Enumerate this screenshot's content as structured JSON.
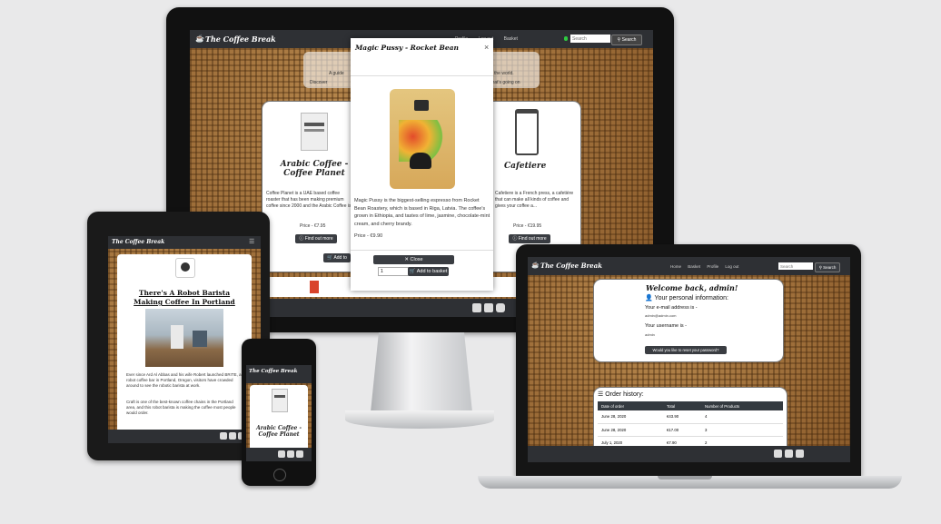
{
  "brand": "The Coffee Break",
  "navbar": {
    "links": [
      "Home",
      "Basket",
      "Profile",
      "Log out"
    ],
    "search_placeholder": "Search",
    "search_button": "Search"
  },
  "modal": {
    "title": "Magic Pussy - Rocket Bean",
    "close_x": "×",
    "description": "Magic Pussy is the biggest-selling espresso from Rocket Bean Roastery, which is based in Riga, Latvia. The coffee's grown in Ethiopia, and tastes of lime, jasmine, chocolate-mint cream, and cherry brandy.",
    "price": "Price - €9.90",
    "close_button": "Close",
    "quantity": "1",
    "add_button": "Add to basket"
  },
  "desktop": {
    "banner_line1": "A guide",
    "banner_line1b": "the world.",
    "banner_line2": "Discover",
    "banner_line2b": "what's going on",
    "products": [
      {
        "name": "Arabic Coffee - Coffee Planet",
        "desc": "Coffee Planet is a UAE based coffee roaster that has been making premium coffee since 2000 and the Arabic Coffee is one of...",
        "price": "Price - €7.95",
        "button": "Find out more"
      },
      {
        "name": "Cafetiere",
        "desc": "Cafetiere is a French press, a cafetière that can make all kinds of coffee and gives your coffee a...",
        "price": "Price - €19.95",
        "button": "Find out more"
      }
    ],
    "add_label": "Add to"
  },
  "tablet": {
    "article_title": "There's A Robot Barista Making Coffee In Portland",
    "para1": "Ever since Ard Al Abbas and his wife Robert launched BRITE, a robot coffee bar in Portland, Oregon, visitors have crowded around to see the robotic barista at work.",
    "para2": "Craft is one of the best-known coffee chains in the Portland area, and this robot barista is making the coffee most people would order."
  },
  "phone": {
    "product_name": "Arabic Coffee - Coffee Planet"
  },
  "laptop": {
    "welcome": "Welcome back, admin!",
    "personal_heading": "Your personal information:",
    "email_label": "Your e-mail address is -",
    "email_value": "admin@admin.com",
    "username_label": "Your username is -",
    "username_value": "admin",
    "reset_button": "Would you like to reset your password?",
    "order_heading": "Order history:",
    "columns": [
      "Date of order",
      "Total",
      "Number of Products"
    ],
    "rows": [
      [
        "June 28, 2020",
        "€43.90",
        "4"
      ],
      [
        "June 28, 2020",
        "€17.00",
        "3"
      ],
      [
        "July 1, 2020",
        "€7.90",
        "2"
      ]
    ]
  },
  "icons": [
    "coffee-icon",
    "facebook-icon",
    "twitter-icon",
    "instagram-icon",
    "search-icon",
    "user-icon",
    "list-icon",
    "basket-icon"
  ]
}
